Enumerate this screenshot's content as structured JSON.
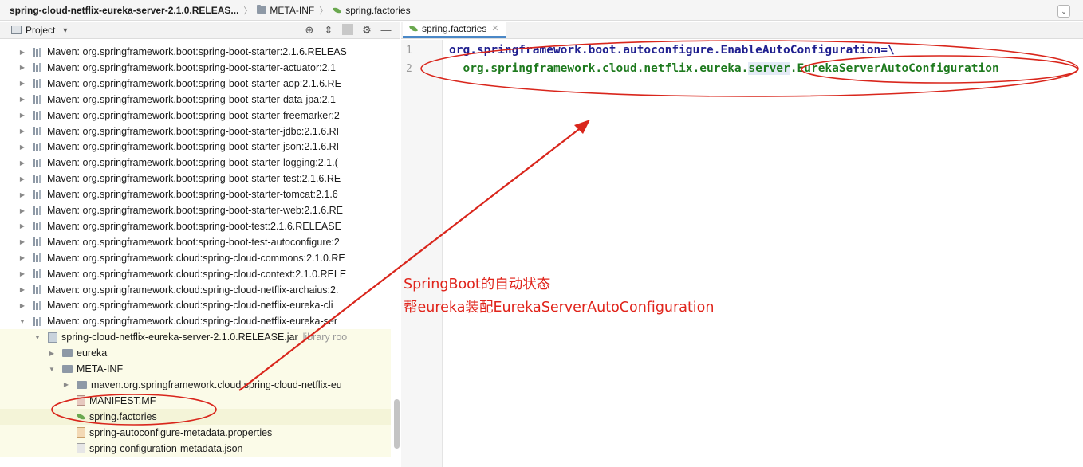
{
  "breadcrumb": {
    "jar": "spring-cloud-netflix-eureka-server-2.1.0.RELEAS...",
    "folder": "META-INF",
    "file": "spring.factories"
  },
  "project_panel": {
    "title": "Project",
    "tree": [
      {
        "arrow": "▶",
        "icon": "library",
        "label": "Maven: org.springframework.boot:spring-boot-starter:2.1.6.RELEAS"
      },
      {
        "arrow": "▶",
        "icon": "library",
        "label": "Maven: org.springframework.boot:spring-boot-starter-actuator:2.1"
      },
      {
        "arrow": "▶",
        "icon": "library",
        "label": "Maven: org.springframework.boot:spring-boot-starter-aop:2.1.6.RE"
      },
      {
        "arrow": "▶",
        "icon": "library",
        "label": "Maven: org.springframework.boot:spring-boot-starter-data-jpa:2.1"
      },
      {
        "arrow": "▶",
        "icon": "library",
        "label": "Maven: org.springframework.boot:spring-boot-starter-freemarker:2"
      },
      {
        "arrow": "▶",
        "icon": "library",
        "label": "Maven: org.springframework.boot:spring-boot-starter-jdbc:2.1.6.RI"
      },
      {
        "arrow": "▶",
        "icon": "library",
        "label": "Maven: org.springframework.boot:spring-boot-starter-json:2.1.6.RI"
      },
      {
        "arrow": "▶",
        "icon": "library",
        "label": "Maven: org.springframework.boot:spring-boot-starter-logging:2.1.("
      },
      {
        "arrow": "▶",
        "icon": "library",
        "label": "Maven: org.springframework.boot:spring-boot-starter-test:2.1.6.RE"
      },
      {
        "arrow": "▶",
        "icon": "library",
        "label": "Maven: org.springframework.boot:spring-boot-starter-tomcat:2.1.6"
      },
      {
        "arrow": "▶",
        "icon": "library",
        "label": "Maven: org.springframework.boot:spring-boot-starter-web:2.1.6.RE"
      },
      {
        "arrow": "▶",
        "icon": "library",
        "label": "Maven: org.springframework.boot:spring-boot-test:2.1.6.RELEASE"
      },
      {
        "arrow": "▶",
        "icon": "library",
        "label": "Maven: org.springframework.boot:spring-boot-test-autoconfigure:2"
      },
      {
        "arrow": "▶",
        "icon": "library",
        "label": "Maven: org.springframework.cloud:spring-cloud-commons:2.1.0.RE"
      },
      {
        "arrow": "▶",
        "icon": "library",
        "label": "Maven: org.springframework.cloud:spring-cloud-context:2.1.0.RELE"
      },
      {
        "arrow": "▶",
        "icon": "library",
        "label": "Maven: org.springframework.cloud:spring-cloud-netflix-archaius:2."
      },
      {
        "arrow": "▶",
        "icon": "library",
        "label": "Maven: org.springframework.cloud:spring-cloud-netflix-eureka-cli"
      },
      {
        "arrow": "▼",
        "icon": "library",
        "label": "Maven: org.springframework.cloud:spring-cloud-netflix-eureka-ser"
      },
      {
        "arrow": "▼",
        "icon": "jar",
        "label": "spring-cloud-netflix-eureka-server-2.1.0.RELEASE.jar",
        "suffix": "library roo"
      },
      {
        "arrow": "▶",
        "icon": "package",
        "label": "eureka"
      },
      {
        "arrow": "▼",
        "icon": "package",
        "label": "META-INF"
      },
      {
        "arrow": "▶",
        "icon": "package",
        "label": "maven.org.springframework.cloud.spring-cloud-netflix-eu"
      },
      {
        "arrow": "",
        "icon": "manifest",
        "label": "MANIFEST.MF"
      },
      {
        "arrow": "",
        "icon": "spring-leaf",
        "label": "spring.factories"
      },
      {
        "arrow": "",
        "icon": "properties",
        "label": "spring-autoconfigure-metadata.properties"
      },
      {
        "arrow": "",
        "icon": "json",
        "label": "spring-configuration-metadata.json"
      }
    ]
  },
  "editor": {
    "tab_label": "spring.factories",
    "lines": [
      {
        "number": "1",
        "key": "org.springframework.boot.autoconfigure.EnableAutoConfiguration=\\"
      },
      {
        "number": "2",
        "pre": "  org.springframework.cloud.netflix.eureka.",
        "server": "server",
        "post": ".EurekaServerAutoConfiguration"
      }
    ]
  },
  "annotation": {
    "line1": "SpringBoot的自动状态",
    "line2": "帮eureka装配EurekaServerAutoConfiguration",
    "color": "#e0241b"
  }
}
